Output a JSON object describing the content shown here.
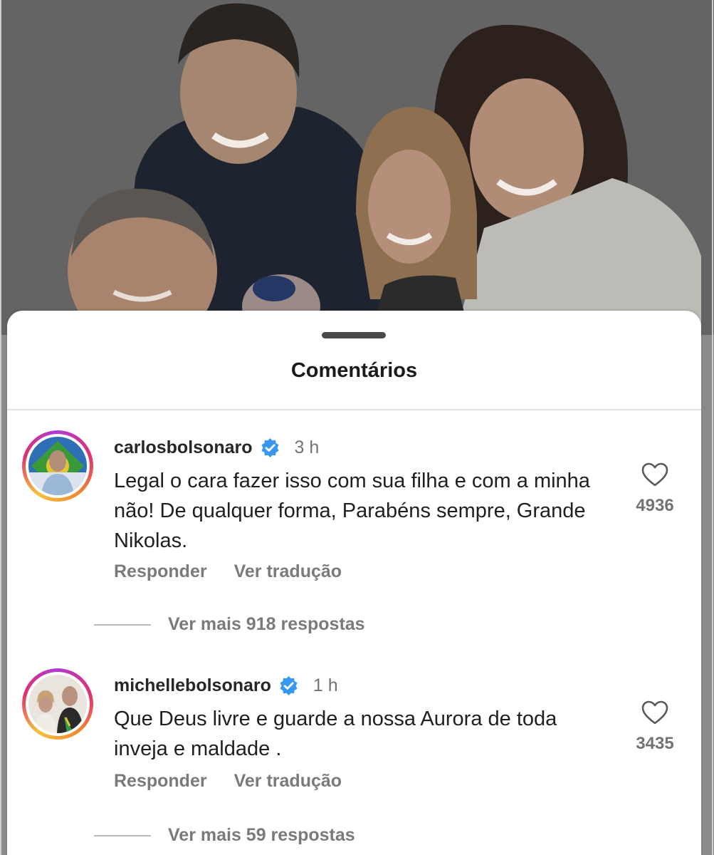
{
  "sheet": {
    "title": "Comentários"
  },
  "comments": [
    {
      "username": "carlosbolsonaro",
      "time": "3 h",
      "text": "Legal o cara fazer isso com sua filha e com a minha não! De qualquer forma, Parabéns sempre, Grande Nikolas.",
      "reply_label": "Responder",
      "translate_label": "Ver tradução",
      "likes": "4936",
      "more_replies": "Ver mais 918 respostas",
      "verified": true
    },
    {
      "username": "michellebolsonaro",
      "time": "1 h",
      "text": "Que Deus livre e guarde a  nossa Aurora de toda inveja e maldade .",
      "reply_label": "Responder",
      "translate_label": "Ver tradução",
      "likes": "3435",
      "more_replies": "Ver mais 59 respostas",
      "verified": true
    }
  ],
  "colors": {
    "verified_badge": "#3897f0",
    "text_primary": "#262626",
    "text_secondary": "#737373"
  },
  "icons": {
    "verified": "verified-badge-icon",
    "like": "heart-outline-icon"
  }
}
